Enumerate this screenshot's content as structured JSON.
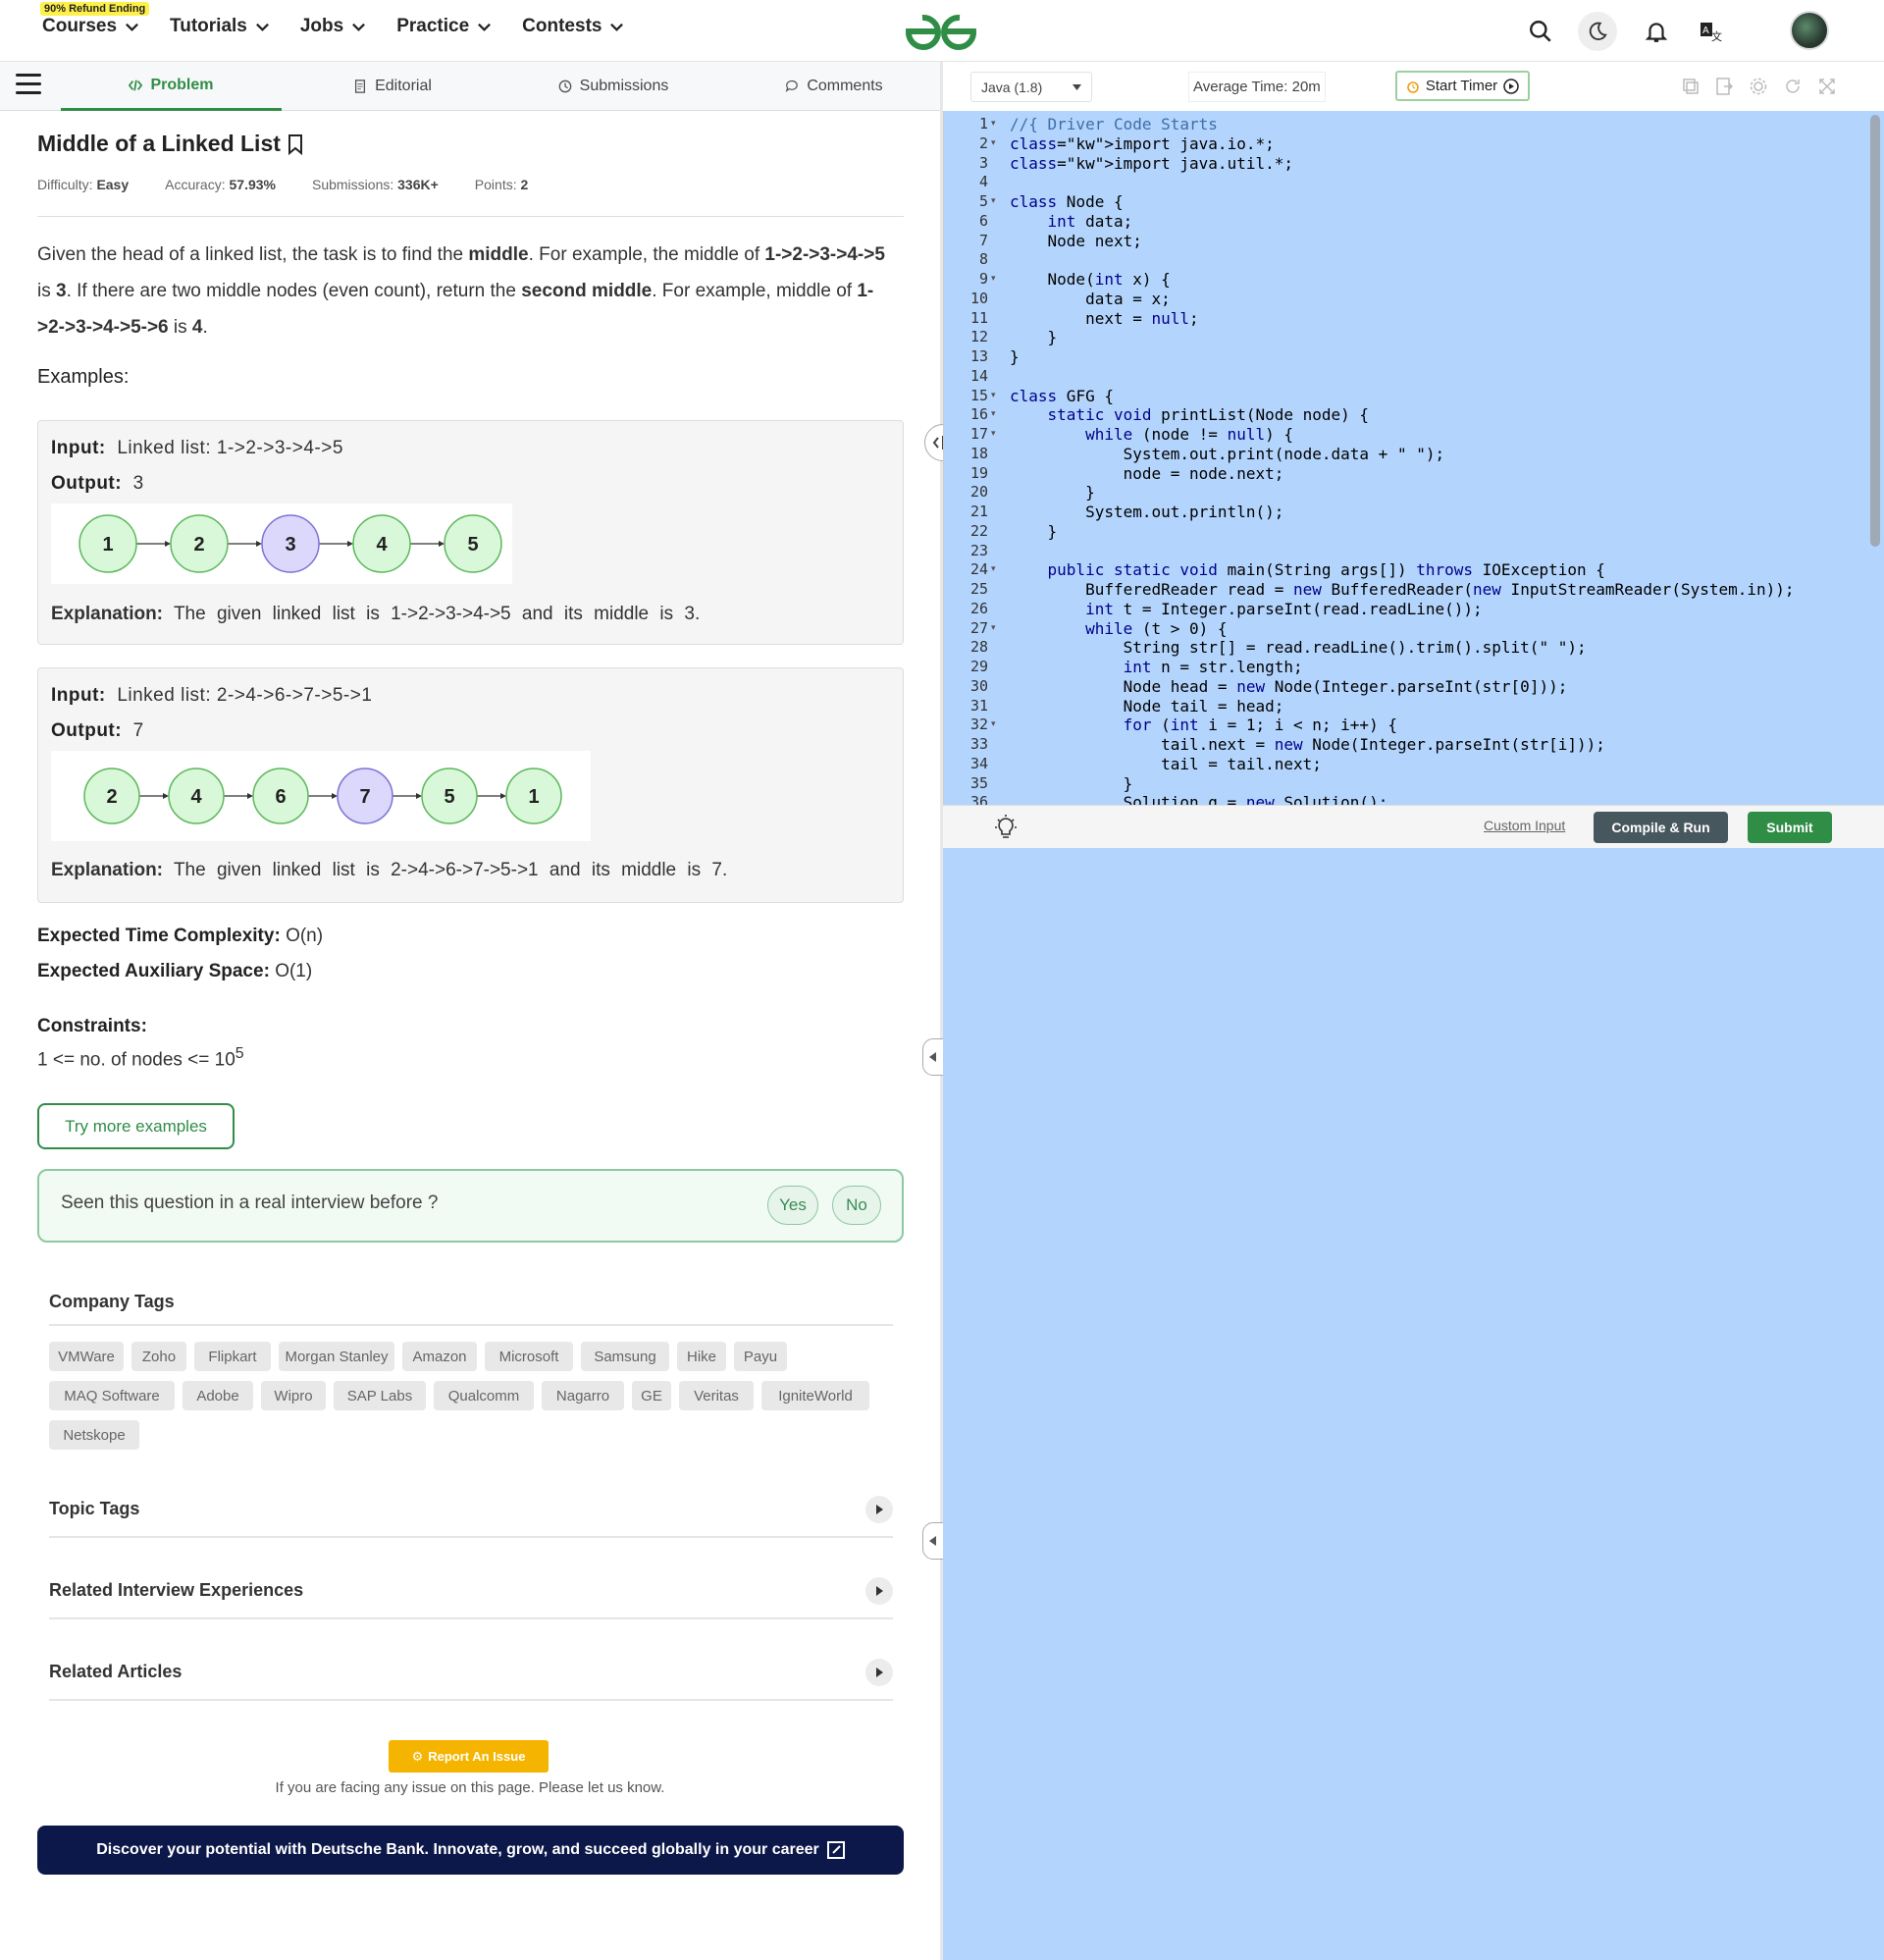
{
  "nav": {
    "refund_badge": "90% Refund Ending",
    "items": [
      "Courses",
      "Tutorials",
      "Jobs",
      "Practice",
      "Contests"
    ]
  },
  "tabs": {
    "problem": "Problem",
    "editorial": "Editorial",
    "submissions": "Submissions",
    "comments": "Comments"
  },
  "problem": {
    "title": "Middle of a Linked List",
    "meta": [
      {
        "label": "Difficulty:",
        "value": "Easy"
      },
      {
        "label": "Accuracy:",
        "value": "57.93%"
      },
      {
        "label": "Submissions:",
        "value": "336K+"
      },
      {
        "label": "Points:",
        "value": "2"
      }
    ],
    "desc": {
      "t1": "Given the head of a linked list, the task is to find the ",
      "b1": "middle",
      "t2": ". For example, the middle of ",
      "b2": "1->2->3->4->5",
      "t3": " is ",
      "b3": "3",
      "t4": ". If there are two middle nodes (even count), return the ",
      "b4": "second middle",
      "t5": ". For example, middle of ",
      "b5": "1->2->3->4->5->6",
      "t6": " is ",
      "b6": "4",
      "t7": "."
    },
    "examples_title": "Examples:",
    "input_label": "Input:",
    "output_label": "Output:",
    "explanation_label": "Explanation:",
    "examples": [
      {
        "input": "Linked list: 1->2->3->4->5",
        "output": "3",
        "nodes": [
          "1",
          "2",
          "3",
          "4",
          "5"
        ],
        "middle_index": 2,
        "explanation": "The given linked list is 1->2->3->4->5 and its middle is 3."
      },
      {
        "input": "Linked list: 2->4->6->7->5->1",
        "output": "7",
        "nodes": [
          "2",
          "4",
          "6",
          "7",
          "5",
          "1"
        ],
        "middle_index": 3,
        "explanation": "The given linked list is 2->4->6->7->5->1 and its middle is 7."
      }
    ],
    "time_label": "Expected Time Complexity:",
    "time_value": "O(n)",
    "space_label": "Expected Auxiliary Space:",
    "space_value": "O(1)",
    "constraints_label": "Constraints:",
    "constraint": "1 <= no. of nodes <= 10",
    "constraint_sup": "5",
    "try_more": "Try more examples",
    "seen_question": "Seen this question in a real interview before ?",
    "yes": "Yes",
    "no": "No"
  },
  "company_tags_title": "Company Tags",
  "company_tags": [
    "VMWare",
    "Zoho",
    "Flipkart",
    "Morgan Stanley",
    "Amazon",
    "Microsoft",
    "Samsung",
    "Hike",
    "Payu",
    "MAQ Software",
    "Adobe",
    "Wipro",
    "SAP Labs",
    "Qualcomm",
    "Nagarro",
    "GE",
    "Veritas",
    "IgniteWorld",
    "Netskope"
  ],
  "sections": [
    "Topic Tags",
    "Related Interview Experiences",
    "Related Articles"
  ],
  "report": {
    "button": "Report An Issue",
    "text": "If you are facing any issue on this page. Please let us know."
  },
  "banner": "Discover your potential with Deutsche Bank. Innovate, grow, and succeed globally in your career",
  "editor": {
    "language": "Java (1.8)",
    "avg_time": "Average Time: 20m",
    "start_timer": "Start Timer",
    "custom_input": "Custom Input",
    "compile_run": "Compile & Run",
    "submit": "Submit",
    "fold_lines": [
      1,
      2,
      5,
      9,
      15,
      16,
      17,
      24,
      27,
      32
    ],
    "lines": [
      "//{ Driver Code Starts",
      "import java.io.*;",
      "import java.util.*;",
      "",
      "class Node {",
      "    int data;",
      "    Node next;",
      "",
      "    Node(int x) {",
      "        data = x;",
      "        next = null;",
      "    }",
      "}",
      "",
      "class GFG {",
      "    static void printList(Node node) {",
      "        while (node != null) {",
      "            System.out.print(node.data + \" \");",
      "            node = node.next;",
      "        }",
      "        System.out.println();",
      "    }",
      "",
      "    public static void main(String args[]) throws IOException {",
      "        BufferedReader read = new BufferedReader(new InputStreamReader(System.in));",
      "        int t = Integer.parseInt(read.readLine());",
      "        while (t > 0) {",
      "            String str[] = read.readLine().trim().split(\" \");",
      "            int n = str.length;",
      "            Node head = new Node(Integer.parseInt(str[0]));",
      "            Node tail = head;",
      "            for (int i = 1; i < n; i++) {",
      "                tail.next = new Node(Integer.parseInt(str[i]));",
      "                tail = tail.next;",
      "            }",
      "            Solution g = new Solution();"
    ]
  },
  "colors": {
    "brand": "#2f8d46",
    "node_fill": "#d9f7d9",
    "node_stroke": "#5cb85c",
    "middle_fill": "#dcd8fb",
    "middle_stroke": "#7b73d6",
    "editor_bg": "#b3d4fc",
    "banner": "#0c1849"
  }
}
